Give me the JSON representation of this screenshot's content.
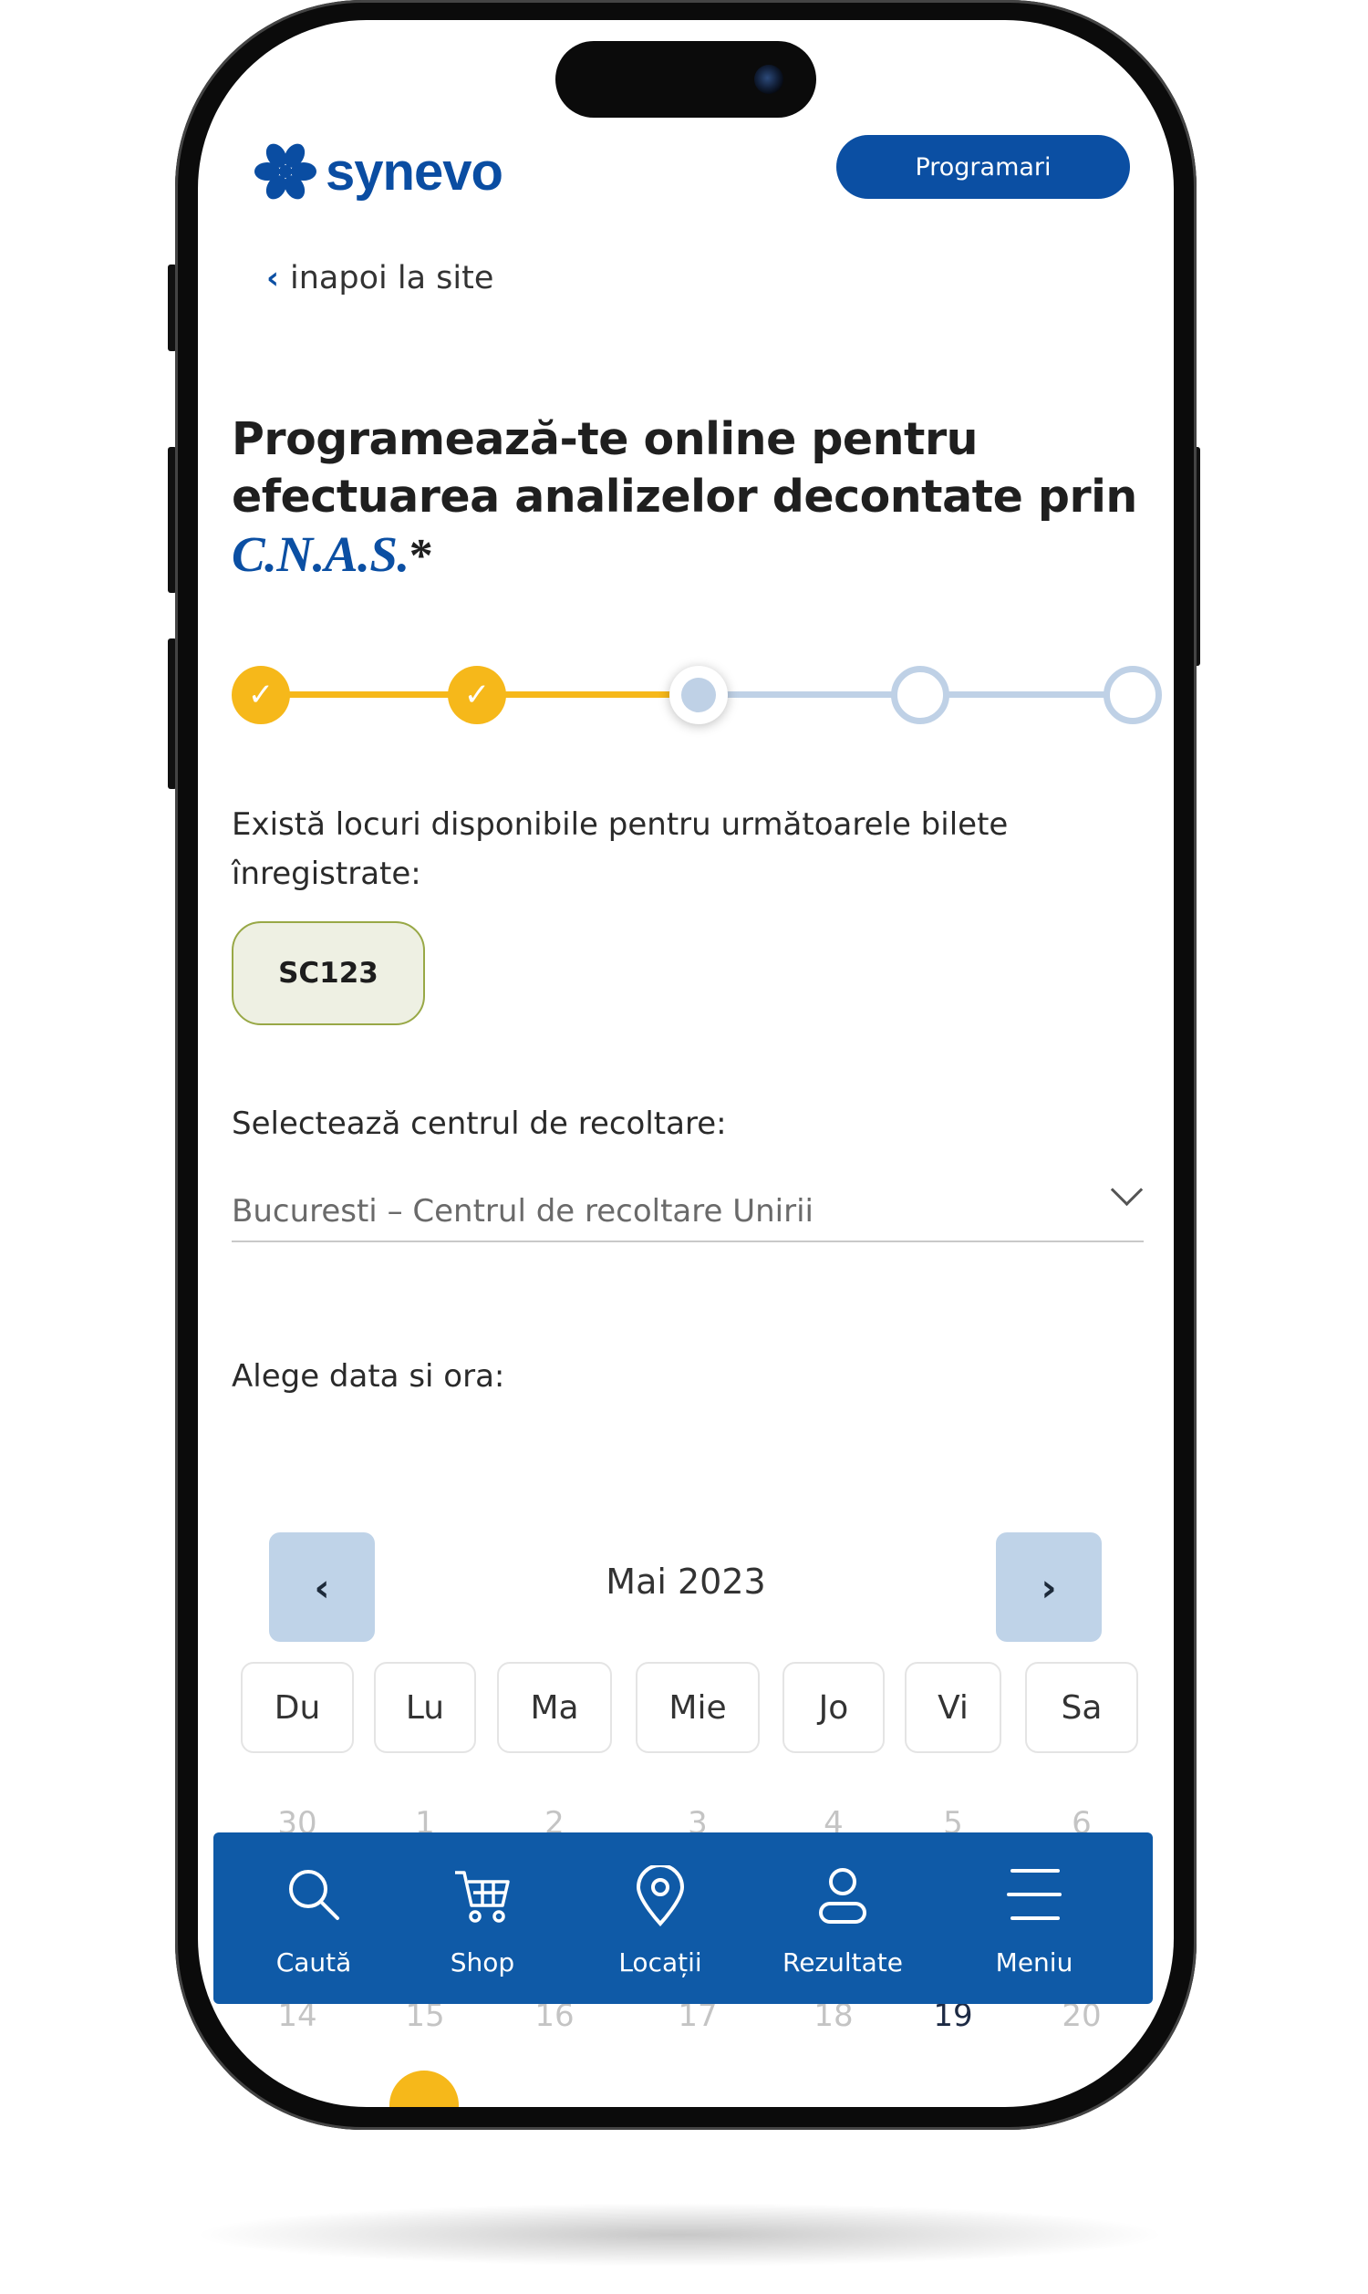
{
  "header": {
    "logo_text": "synevo",
    "appointments_button": "Programari",
    "back_link": "inapoi la site"
  },
  "title": {
    "line1": "Programează-te online pentru",
    "line2": "efectuarea analizelor decontate prin",
    "cnas": "C.N.A.S.",
    "asterisk": "*"
  },
  "stepper": {
    "current_step": 3,
    "total_steps": 5,
    "colors": {
      "done": "#f6b81a",
      "todo": "#bfd1e6"
    }
  },
  "tickets": {
    "info": "Există locuri disponibile pentru următoarele bilete înregistrate:",
    "items": [
      "SC123"
    ]
  },
  "center": {
    "label": "Selectează centrul de recoltare:",
    "value": "Bucuresti – Centrul de recoltare Unirii"
  },
  "date": {
    "label": "Alege data si ora:"
  },
  "calendar": {
    "month": "Mai 2023",
    "weekdays": [
      "Du",
      "Lu",
      "Ma",
      "Mie",
      "Jo",
      "Vi",
      "Sa"
    ],
    "row1": [
      "30",
      "1",
      "2",
      "3",
      "4",
      "5",
      "6"
    ],
    "row3": [
      "14",
      "15",
      "16",
      "17",
      "18",
      "19",
      "20"
    ]
  },
  "bottom_nav": {
    "items": [
      {
        "label": "Caută",
        "icon": "search-icon"
      },
      {
        "label": "Shop",
        "icon": "cart-icon"
      },
      {
        "label": "Locații",
        "icon": "location-pin-icon"
      },
      {
        "label": "Rezultate",
        "icon": "user-icon"
      },
      {
        "label": "Meniu",
        "icon": "menu-icon"
      }
    ]
  },
  "colors": {
    "brand_blue": "#0b4fa3",
    "accent_yellow": "#f6b81a",
    "nav_blue": "#0f5aa7"
  }
}
